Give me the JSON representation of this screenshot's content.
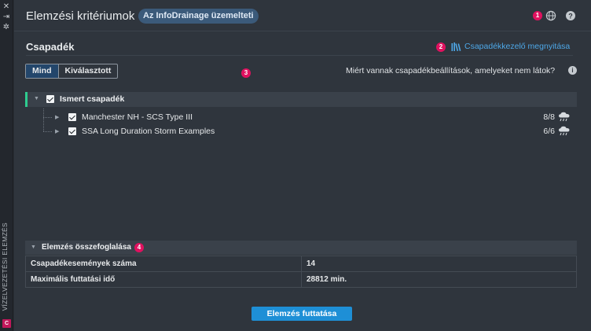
{
  "left_strip": {
    "icons": [
      "close-icon",
      "collapse-icon",
      "settings-icon"
    ],
    "vertical_label": "VÍZELVEZETÉSI ELEMZÉS",
    "app_badge": "C"
  },
  "header": {
    "title": "Elemzési kritériumok",
    "pill": "Az InfoDrainage üzemelteti",
    "markers": [
      "1",
      "2",
      "3",
      "4"
    ],
    "icons": [
      "globe-icon",
      "help-icon"
    ]
  },
  "section": {
    "title": "Csapadék",
    "open_link": "Csapadékkezelő megnyitása",
    "link_icon": "library-icon"
  },
  "filter": {
    "tabs": [
      {
        "label": "Mind",
        "active": true
      },
      {
        "label": "Kiválasztott",
        "active": false
      }
    ]
  },
  "why_text": "Miért vannak csapadékbeállítások, amelyeket nem látok?",
  "info_icon_glyph": "i",
  "tree": {
    "group": {
      "label": "Ismert csapadék",
      "checked": true,
      "expanded": true
    },
    "items": [
      {
        "label": "Manchester NH - SCS Type III",
        "count": "8/8",
        "checked": true,
        "icon": "rain-icon"
      },
      {
        "label": "SSA Long Duration Storm Examples",
        "count": "6/6",
        "checked": true,
        "icon": "rain-icon"
      }
    ]
  },
  "summary": {
    "title": "Elemzés összefoglalása",
    "rows": [
      {
        "key": "Csapadékesemények száma",
        "value": "14"
      },
      {
        "key": "Maximális futtatási idő",
        "value": "28812 min."
      }
    ]
  },
  "run_button": "Elemzés futtatása",
  "colors": {
    "accent": "#1e8fd6",
    "link": "#4ea8e8",
    "marker": "#e0115f",
    "group_bar": "#2ecc8f",
    "pill_bg": "#3b5a7a",
    "active_tab_bg": "#23466b"
  }
}
